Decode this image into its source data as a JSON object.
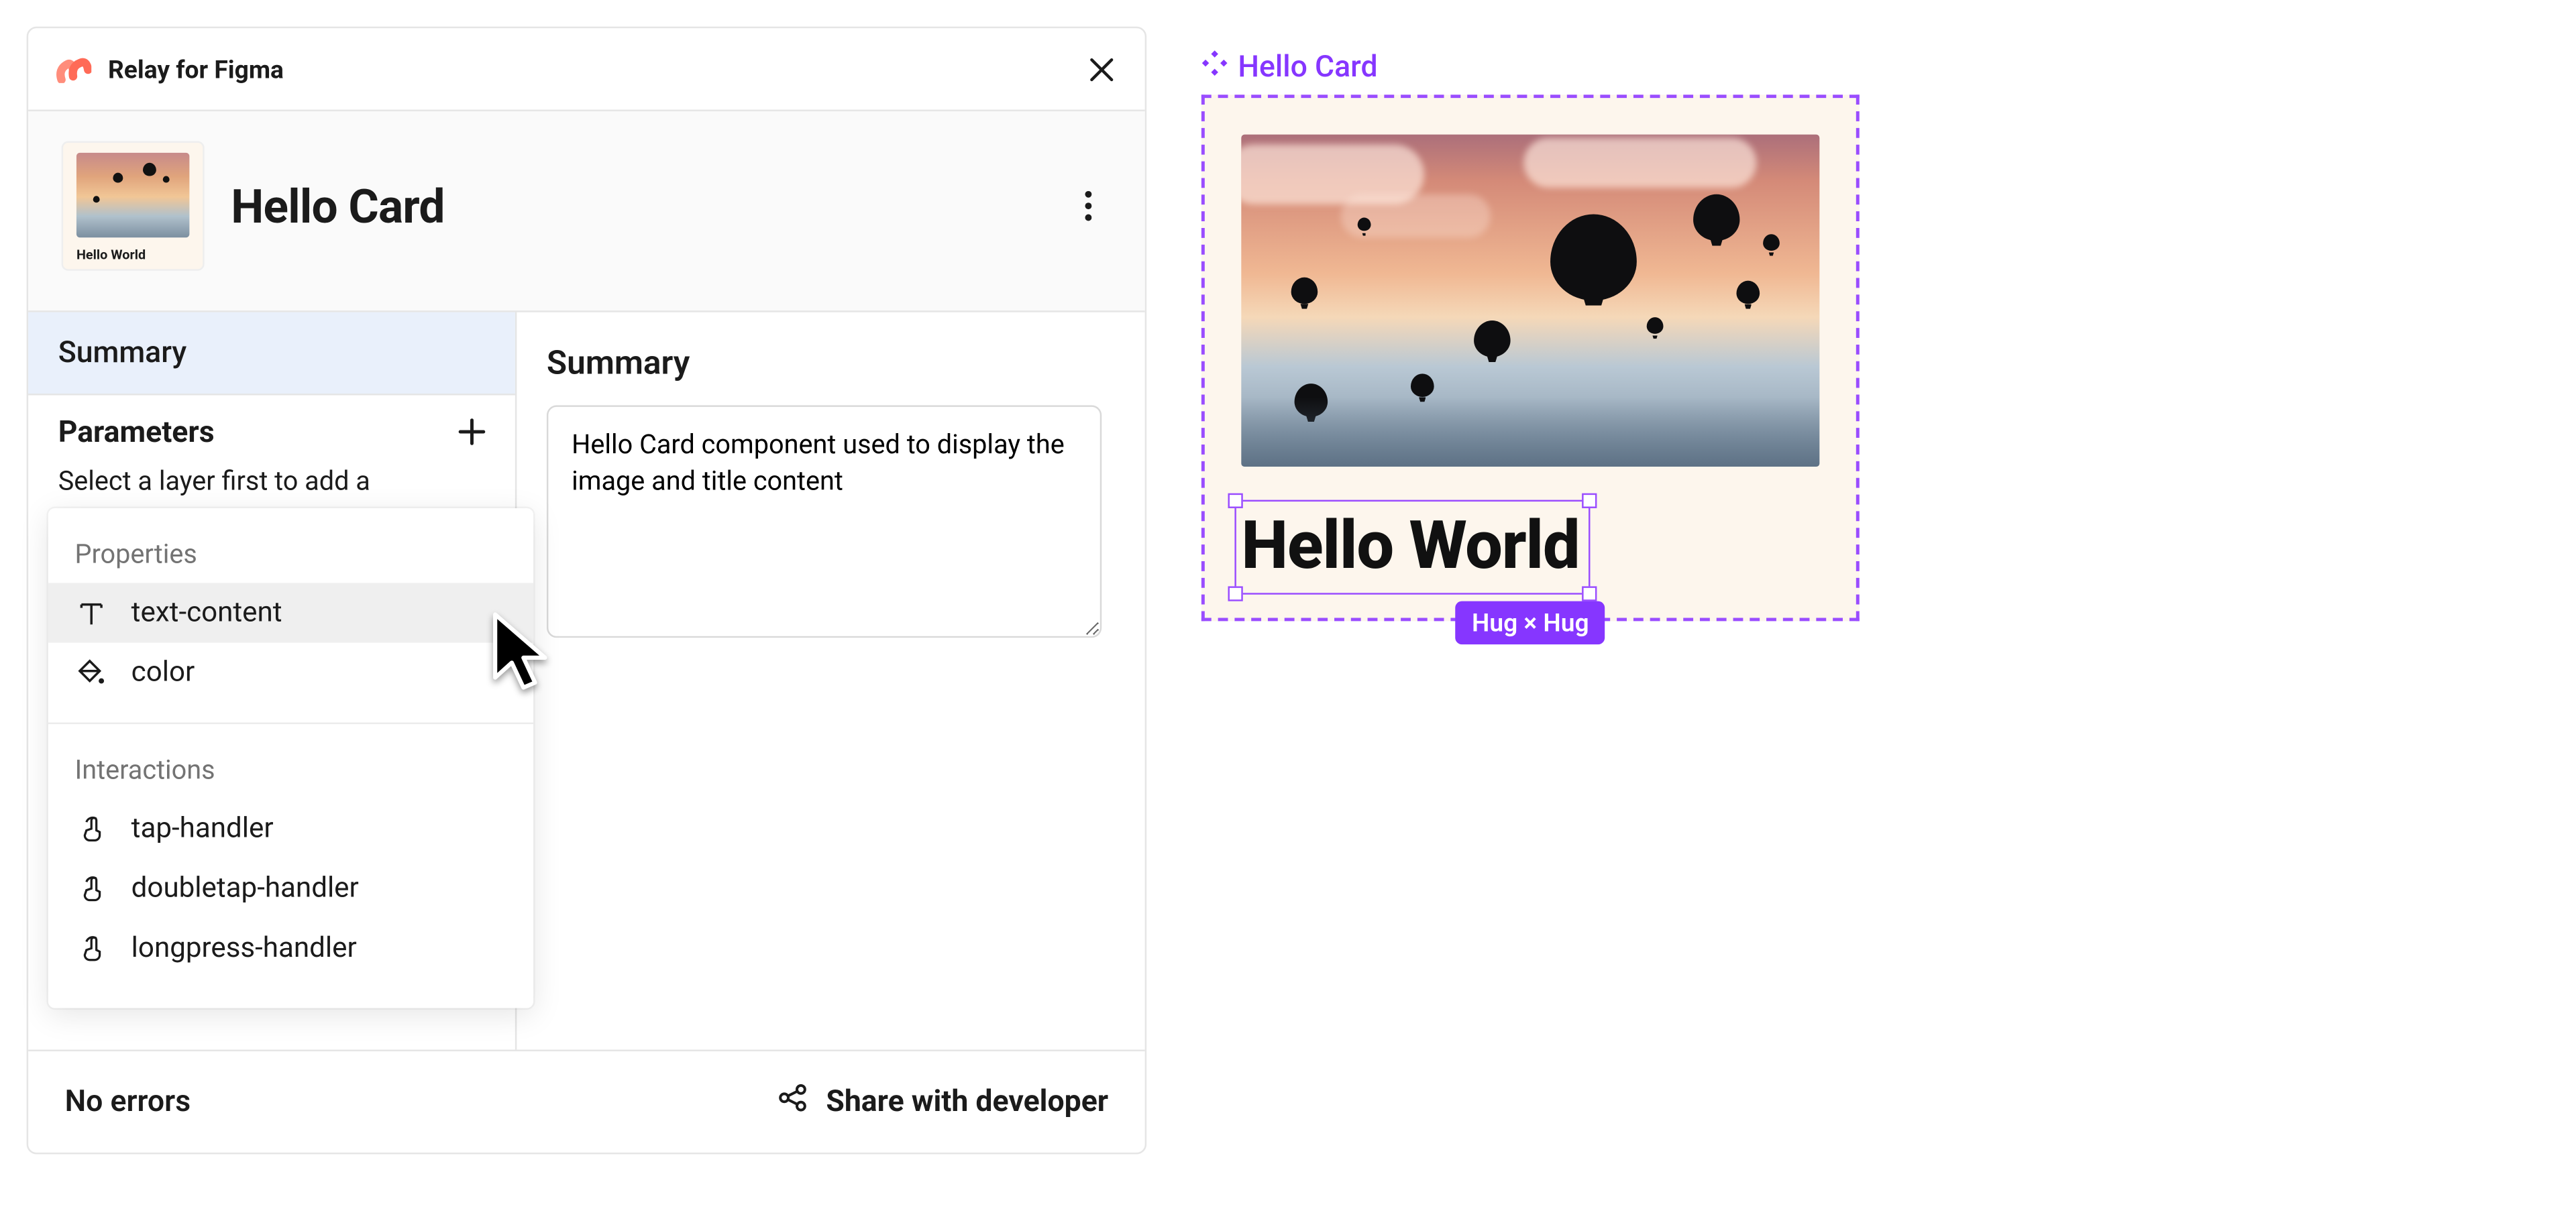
{
  "colors": {
    "purple": "#8636ff"
  },
  "titlebar": {
    "app_name": "Relay for Figma"
  },
  "header": {
    "component_name": "Hello Card",
    "thumbnail_caption": "Hello World"
  },
  "sidebar": {
    "tabs": {
      "summary": "Summary"
    },
    "parameters_label": "Parameters",
    "parameters_hint": "Select a layer first to add a"
  },
  "main": {
    "heading": "Summary",
    "summary_text": "Hello Card component used to display the image and title content"
  },
  "popover": {
    "group_properties": "Properties",
    "group_interactions": "Interactions",
    "properties": [
      {
        "icon": "text-icon",
        "label": "text-content"
      },
      {
        "icon": "fill-icon",
        "label": "color"
      }
    ],
    "interactions": [
      {
        "icon": "tap-icon",
        "label": "tap-handler"
      },
      {
        "icon": "tap-icon",
        "label": "doubletap-handler"
      },
      {
        "icon": "tap-icon",
        "label": "longpress-handler"
      }
    ]
  },
  "footer": {
    "status": "No errors",
    "share_label": "Share with developer"
  },
  "canvas": {
    "component_label": "Hello Card",
    "text_value": "Hello World",
    "size_label": "Hug × Hug"
  }
}
